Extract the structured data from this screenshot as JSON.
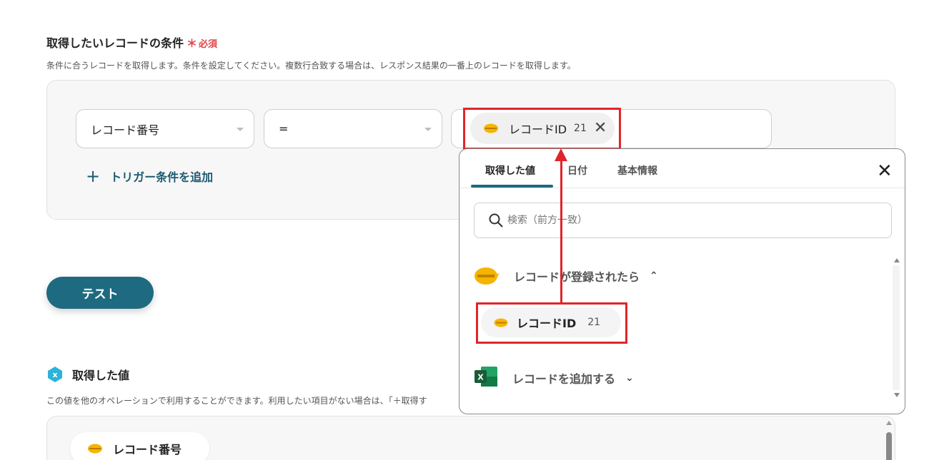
{
  "section": {
    "title": "取得したいレコードの条件",
    "required_mark": "＊",
    "required_label": "必須",
    "description": "条件に合うレコードを取得します。条件を設定してください。複数行合致する場合は、レスポンス結果の一番上のレコードを取得します。"
  },
  "condition": {
    "field_value": "レコード番号",
    "operator_value": "=",
    "value_chip": {
      "label": "レコードID",
      "count": "21",
      "remove": "✕"
    },
    "add_trigger_label": "トリガー条件を追加",
    "add_trigger_plus": "+"
  },
  "test_button": "テスト",
  "obtained": {
    "title": "取得した値",
    "description": "この値を他のオペレーションで利用することができます。利用したい項目がない場合は、「＋取得す",
    "chip_label": "レコード番号"
  },
  "popup": {
    "tabs": [
      {
        "label": "取得した値"
      },
      {
        "label": "日付"
      },
      {
        "label": "基本情報"
      }
    ],
    "close": "✕",
    "search_placeholder": "検索（前方一致）",
    "group1": {
      "label": "レコードが登録されたら",
      "chevron": "⌃"
    },
    "item": {
      "label": "レコードID",
      "count": "21"
    },
    "group2": {
      "label": "レコードを追加する",
      "chevron": "⌄"
    }
  },
  "colors": {
    "accent": "#1e6a80",
    "required": "#e0424a",
    "highlight": "#e0252a",
    "kintone": "#f6b400",
    "excel": "#1d6f42"
  },
  "icons": {
    "kintone": "kintone-logo-icon",
    "excel": "excel-icon",
    "search": "search-icon",
    "obtained": "variable-icon"
  }
}
